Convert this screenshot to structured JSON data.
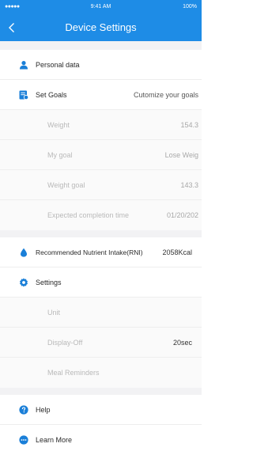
{
  "status_bar": {
    "signal": "●●●●●",
    "time": "9:41 AM",
    "battery": "100%"
  },
  "nav": {
    "title": "Device Settings"
  },
  "rows": {
    "personal_data": {
      "label": "Personal data"
    },
    "set_goals": {
      "label": "Set Goals",
      "value": "Cutomize your goals"
    },
    "weight": {
      "label": "Weight",
      "value": "154.3"
    },
    "my_goal": {
      "label": "My goal",
      "value": "Lose Weig"
    },
    "weight_goal": {
      "label": "Weight goal",
      "value": "143.3"
    },
    "expected_completion": {
      "label": "Expected completion time",
      "value": "01/20/202"
    },
    "rni": {
      "label": "Recommended Nutrient Intake(RNI)",
      "value": "2058Kcal"
    },
    "settings": {
      "label": "Settings"
    },
    "unit": {
      "label": "Unit"
    },
    "display_off": {
      "label": "Display-Off",
      "value": "20sec"
    },
    "meal_reminders": {
      "label": "Meal Reminders"
    },
    "help": {
      "label": "Help"
    },
    "learn_more": {
      "label": "Learn More"
    }
  },
  "colors": {
    "header_blue": "#1e8ce6",
    "icon_blue": "#1a7fd8",
    "section_gray": "#f2f2f4",
    "muted_text": "#b9b9b9"
  },
  "icons": {
    "personal_data": "person-icon",
    "set_goals": "goal-list-icon",
    "rni": "water-drop-icon",
    "settings": "gear-icon",
    "help": "question-icon",
    "learn_more": "more-dots-icon"
  }
}
